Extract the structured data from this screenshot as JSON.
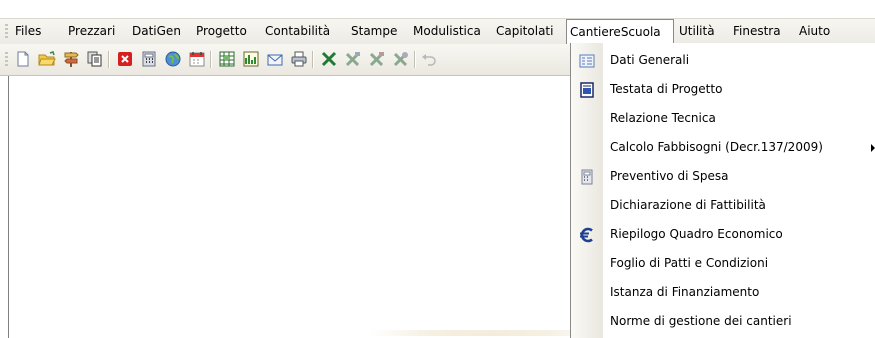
{
  "menubar": {
    "items": [
      {
        "label": "Files"
      },
      {
        "label": "Prezzari"
      },
      {
        "label": "DatiGen"
      },
      {
        "label": "Progetto"
      },
      {
        "label": "Contabilità"
      },
      {
        "label": "Stampe"
      },
      {
        "label": "Modulistica"
      },
      {
        "label": "Capitolati"
      },
      {
        "label": "CantiereScuola"
      },
      {
        "label": "Utilità"
      },
      {
        "label": "Finestra"
      },
      {
        "label": "Aiuto"
      }
    ]
  },
  "toolbar": {
    "buttons": [
      {
        "icon": "new-document-icon"
      },
      {
        "icon": "open-folder-icon"
      },
      {
        "icon": "signpost-icon"
      },
      {
        "icon": "copy-pages-icon"
      },
      {
        "icon": "close-red-icon"
      },
      {
        "icon": "calculator-icon"
      },
      {
        "icon": "globe-icon"
      },
      {
        "icon": "calendar-icon"
      },
      {
        "icon": "spreadsheet-icon"
      },
      {
        "icon": "chart-icon"
      },
      {
        "icon": "envelope-icon"
      },
      {
        "icon": "printer-icon"
      },
      {
        "icon": "excel-icon"
      },
      {
        "icon": "excel-gray-icon-1"
      },
      {
        "icon": "excel-gray-icon-2"
      },
      {
        "icon": "excel-gray-icon-3"
      },
      {
        "icon": "undo-icon"
      }
    ]
  },
  "dropdown": {
    "items": [
      {
        "label": "Dati Generali",
        "icon": "form-icon"
      },
      {
        "label": "Testata di Progetto",
        "icon": "document-icon"
      },
      {
        "label": "Relazione Tecnica",
        "icon": ""
      },
      {
        "label": "Calcolo Fabbisogni (Decr.137/2009)",
        "icon": "",
        "submenu": true
      },
      {
        "label": "Preventivo di Spesa",
        "icon": "calculator-icon"
      },
      {
        "label": "Dichiarazione di Fattibilità",
        "icon": ""
      },
      {
        "label": "Riepilogo Quadro Economico",
        "icon": "euro-icon"
      },
      {
        "label": "Foglio di Patti e Condizioni",
        "icon": ""
      },
      {
        "label": "Istanza di Finanziamento",
        "icon": ""
      },
      {
        "label": "Norme di gestione dei cantieri",
        "icon": ""
      }
    ]
  },
  "colors": {
    "euro": "#1f3f8f",
    "close_red": "#d42020",
    "excel_green": "#1e7a36",
    "menu_border": "#8a8a8a"
  }
}
